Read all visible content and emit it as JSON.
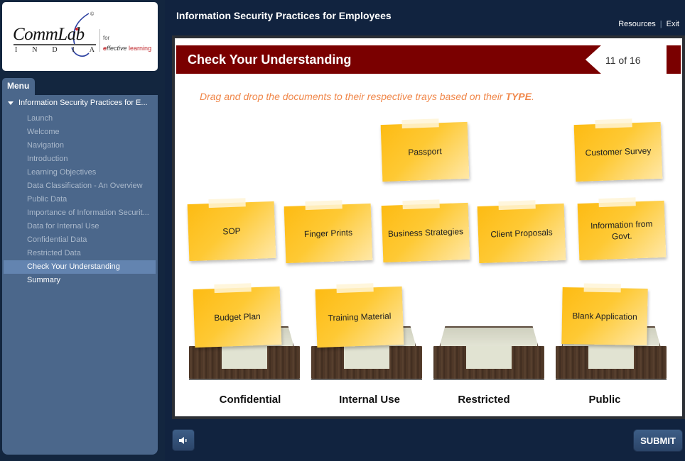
{
  "logo": {
    "brand": "CommLab",
    "sub_letters": [
      "I",
      "N",
      "D",
      "I",
      "A"
    ],
    "copyright": "©",
    "tagline_for": "for",
    "tagline_e": "e",
    "tagline_ffective": "ffective",
    "tagline_learning": "learning"
  },
  "header": {
    "course_title": "Information Security Practices for Employees",
    "links": {
      "resources": "Resources",
      "separator": "|",
      "exit": "Exit"
    }
  },
  "menu": {
    "tab_label": "Menu",
    "root_label": "Information Security Practices for E...",
    "items": [
      {
        "label": "Launch",
        "state": "visited"
      },
      {
        "label": "Welcome",
        "state": "visited"
      },
      {
        "label": "Navigation",
        "state": "visited"
      },
      {
        "label": "Introduction",
        "state": "visited"
      },
      {
        "label": "Learning Objectives",
        "state": "visited"
      },
      {
        "label": "Data Classification - An Overview",
        "state": "visited"
      },
      {
        "label": "Public Data",
        "state": "visited"
      },
      {
        "label": "Importance of Information Securit...",
        "state": "visited"
      },
      {
        "label": "Data for Internal Use",
        "state": "visited"
      },
      {
        "label": "Confidential Data",
        "state": "visited"
      },
      {
        "label": "Restricted Data",
        "state": "visited"
      },
      {
        "label": "Check Your Understanding",
        "state": "current"
      },
      {
        "label": "Summary",
        "state": "unvisited"
      }
    ]
  },
  "slide": {
    "title": "Check Your Understanding",
    "page_indicator": "11 of 16",
    "instruction_prefix": "Drag and drop the documents to their respective trays based on their ",
    "instruction_emphasis": "TYPE",
    "instruction_suffix": ".",
    "notes": {
      "passport": "Passport",
      "customer_survey": "Customer Survey",
      "sop": "SOP",
      "finger_prints": "Finger Prints",
      "business_strategies": "Business Strategies",
      "client_proposals": "Client Proposals",
      "information_from_govt": "Information from Govt.",
      "budget_plan": "Budget Plan",
      "training_material": "Training Material",
      "blank_application": "Blank Application"
    },
    "trays": [
      {
        "label": "Confidential",
        "contains": "Budget Plan"
      },
      {
        "label": "Internal Use",
        "contains": "Training Material"
      },
      {
        "label": "Restricted",
        "contains": ""
      },
      {
        "label": "Public",
        "contains": "Blank Application"
      }
    ]
  },
  "footer": {
    "audio_icon": "speaker-icon",
    "submit_label": "SUBMIT"
  },
  "colors": {
    "background": "#11233f",
    "menu_panel": "#4b678b",
    "menu_current": "#6384b0",
    "title_bar": "#7a0000",
    "instruction": "#f0874a",
    "note": "#fdbb13"
  }
}
